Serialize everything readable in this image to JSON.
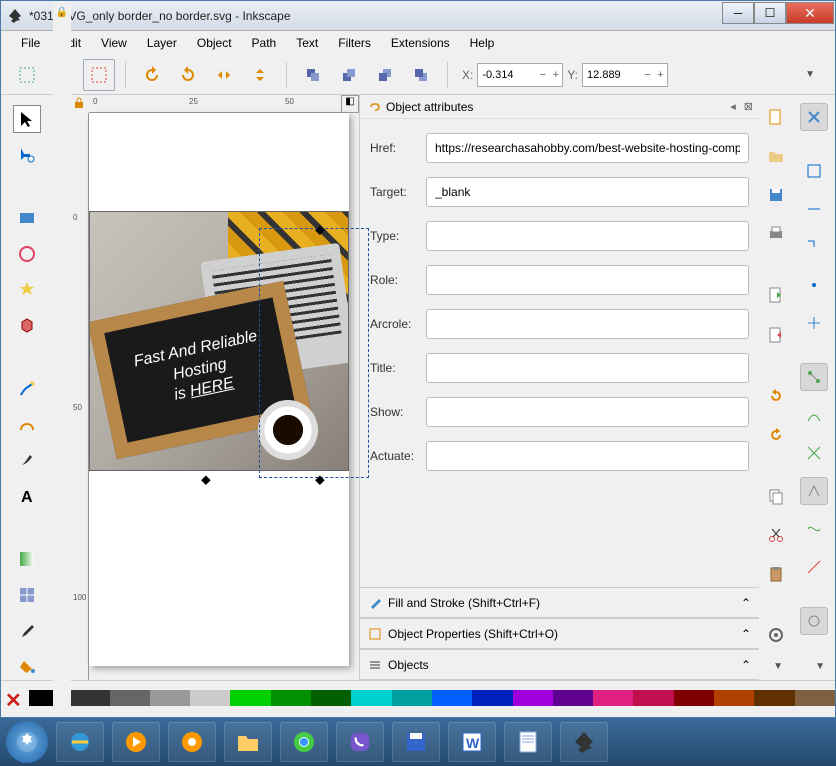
{
  "window": {
    "title": "*031_SVG_only border_no border.svg - Inkscape"
  },
  "menu": [
    "File",
    "Edit",
    "View",
    "Layer",
    "Object",
    "Path",
    "Text",
    "Filters",
    "Extensions",
    "Help"
  ],
  "coords": {
    "x_label": "X:",
    "x": "-0.314",
    "y_label": "Y:",
    "y": "12.889"
  },
  "panel": {
    "title": "Object attributes",
    "attrs": {
      "href_label": "Href:",
      "href": "https://researchasahobby.com/best-website-hosting-comp",
      "target_label": "Target:",
      "target": "_blank",
      "type_label": "Type:",
      "type": "",
      "role_label": "Role:",
      "role": "",
      "arcrole_label": "Arcrole:",
      "arcrole": "",
      "title_label": "Title:",
      "title": "",
      "show_label": "Show:",
      "show": "",
      "actuate_label": "Actuate:",
      "actuate": ""
    },
    "collapsed": [
      "Fill and Stroke (Shift+Ctrl+F)",
      "Object Properties (Shift+Ctrl+O)",
      "Objects"
    ]
  },
  "ruler": {
    "h": [
      "0",
      "25",
      "50"
    ],
    "v": [
      "0",
      "50",
      "100"
    ]
  },
  "chalk": {
    "l1": "Fast And Reliable",
    "l2": "Hosting",
    "l3": "is ",
    "here": "HERE"
  },
  "palette": [
    "#000000",
    "#333333",
    "#666666",
    "#999999",
    "#cccccc",
    "#00d000",
    "#009000",
    "#006000",
    "#00d0d0",
    "#00a0a0",
    "#0060ff",
    "#0020c0",
    "#a000e0",
    "#600090",
    "#e02080",
    "#c01050",
    "#800000",
    "#b04000",
    "#603000",
    "#806040"
  ],
  "taskbar_apps": [
    "ie",
    "media",
    "settings",
    "files",
    "chrome",
    "viber",
    "save",
    "word",
    "notepad",
    "inkscape"
  ]
}
